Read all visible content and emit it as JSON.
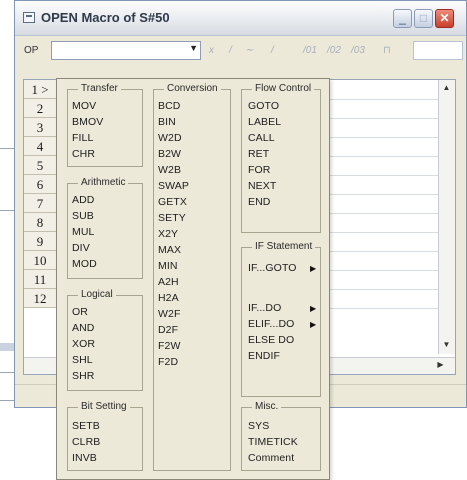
{
  "window": {
    "title": "OPEN Macro of S#50"
  },
  "toolbar": {
    "op_label": "OP",
    "combo_value": "",
    "icons": [
      "italic-x",
      "slash-icon",
      "wave-icon",
      "slash-icon"
    ],
    "tool_labels": [
      "/01",
      "/02",
      "/03"
    ]
  },
  "rows": [
    "1 >",
    "2",
    "3",
    "4",
    "5",
    "6",
    "7",
    "8",
    "9",
    "10",
    "11",
    "12"
  ],
  "menu": {
    "transfer": {
      "title": "Transfer",
      "items": [
        "MOV",
        "BMOV",
        "FILL",
        "CHR"
      ]
    },
    "arithmetic": {
      "title": "Arithmetic",
      "items": [
        "ADD",
        "SUB",
        "MUL",
        "DIV",
        "MOD"
      ]
    },
    "logical": {
      "title": "Logical",
      "items": [
        "OR",
        "AND",
        "XOR",
        "SHL",
        "SHR"
      ]
    },
    "bit_setting": {
      "title": "Bit Setting",
      "items": [
        "SETB",
        "CLRB",
        "INVB"
      ]
    },
    "conversion": {
      "title": "Conversion",
      "items": [
        "BCD",
        "BIN",
        "W2D",
        "B2W",
        "W2B",
        "SWAP",
        "GETX",
        "SETY",
        "X2Y",
        "MAX",
        "MIN",
        "A2H",
        "H2A",
        "W2F",
        "D2F",
        "F2W",
        "F2D"
      ]
    },
    "flow_control": {
      "title": "Flow Control",
      "items": [
        "GOTO",
        "LABEL",
        "CALL",
        "RET",
        "FOR",
        "NEXT",
        "END"
      ]
    },
    "if_statement": {
      "title": "IF Statement",
      "items": [
        "IF...GOTO",
        "IF...DO",
        "ELIF...DO",
        "ELSE DO",
        "ENDIF"
      ]
    },
    "misc": {
      "title": "Misc.",
      "items": [
        "SYS",
        "TIMETICK",
        "Comment"
      ]
    }
  }
}
